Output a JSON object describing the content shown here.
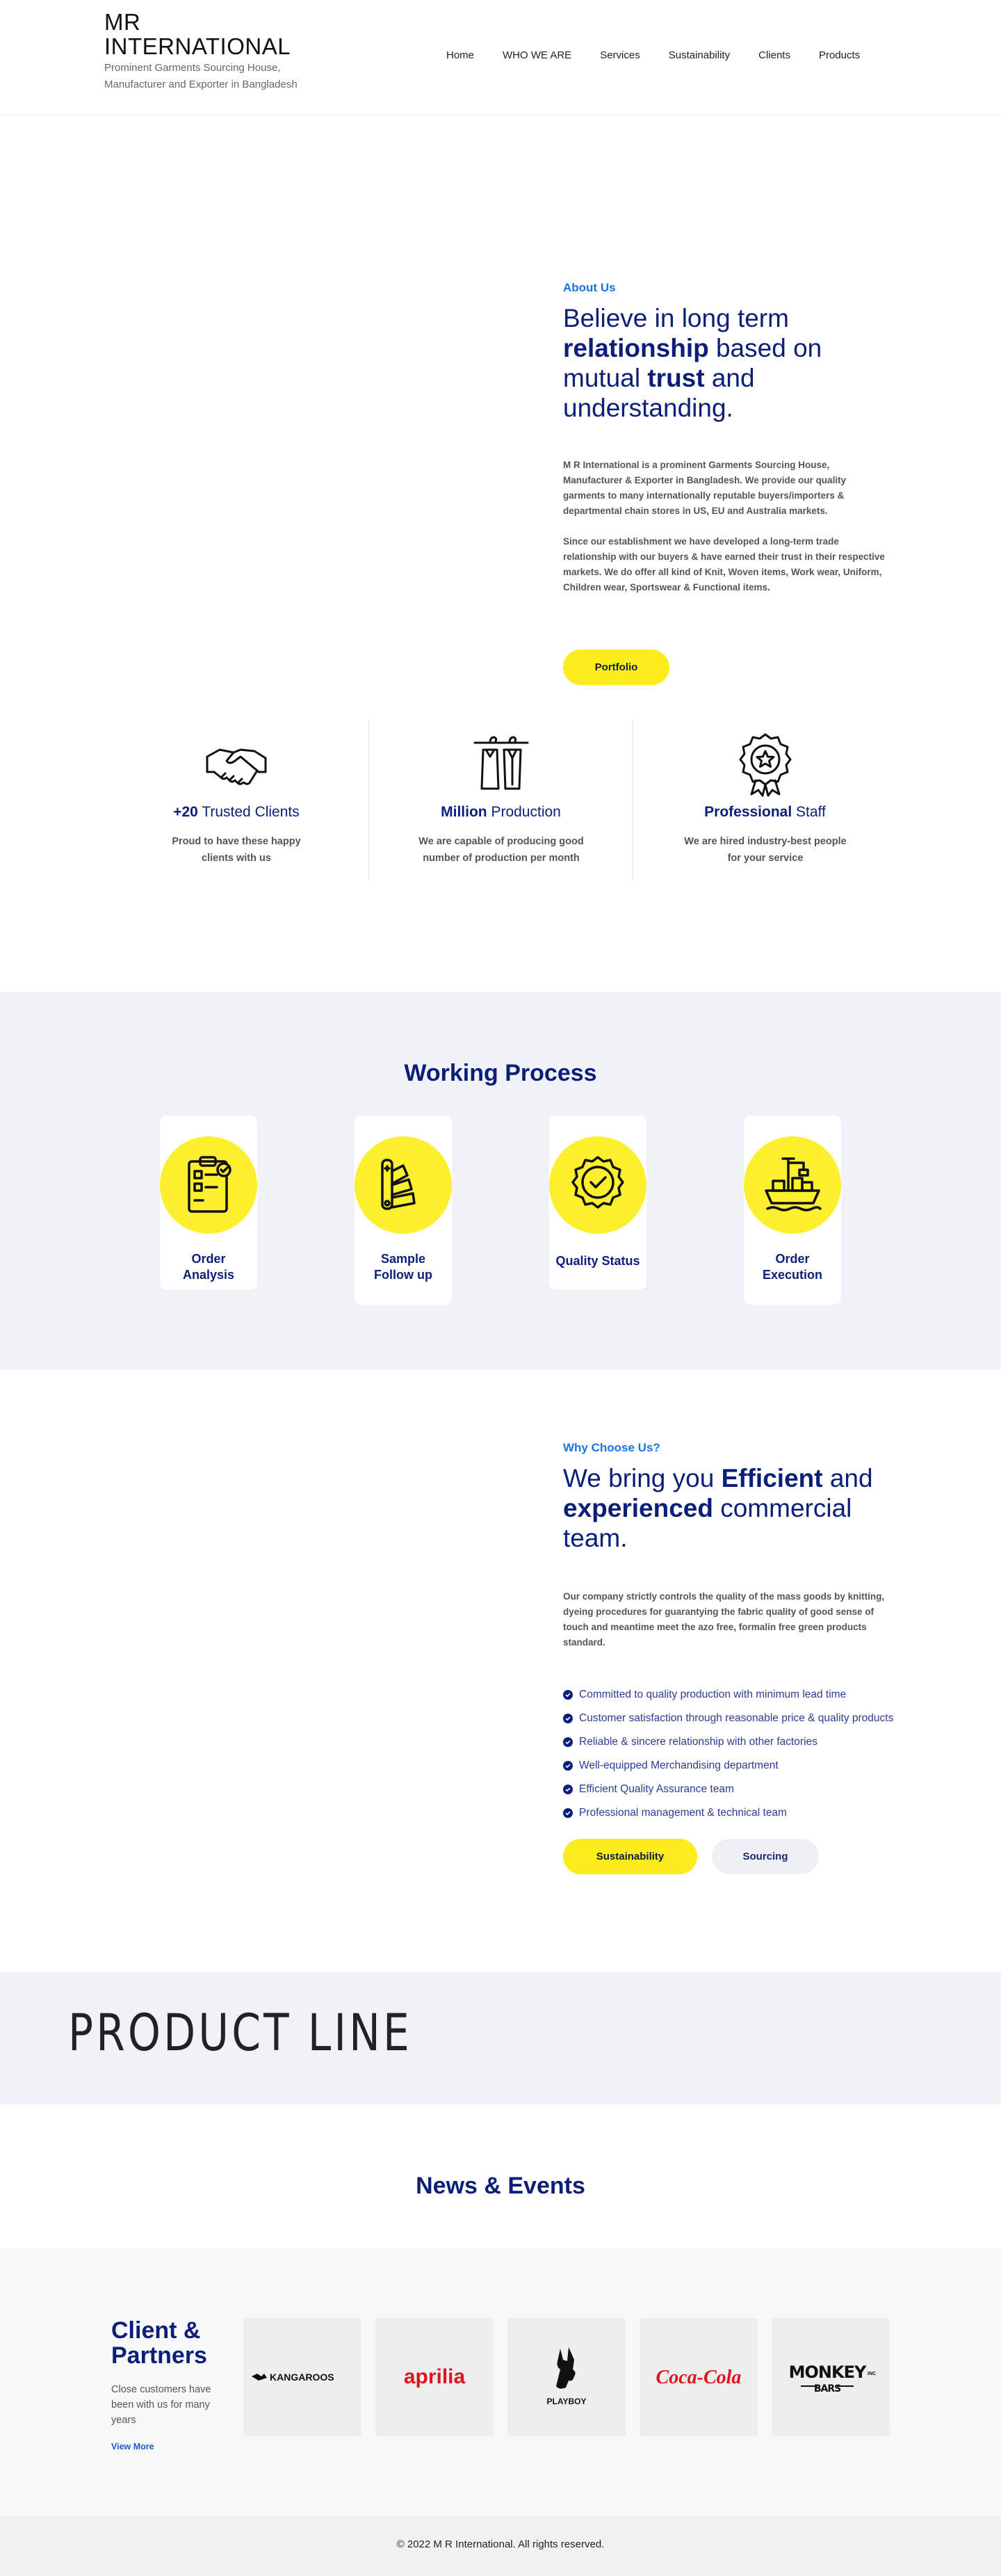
{
  "brand": {
    "name": "MR INTERNATIONAL",
    "tagline": "Prominent Garments Sourcing House, Manufacturer and Exporter in Bangladesh"
  },
  "nav": {
    "items": [
      {
        "label": "Home"
      },
      {
        "label": "WHO WE ARE"
      },
      {
        "label": "Services"
      },
      {
        "label": "Sustainability"
      },
      {
        "label": "Clients"
      },
      {
        "label": "Products"
      }
    ]
  },
  "about": {
    "eyebrow": "About Us",
    "heading": {
      "p1": "Believe in long term ",
      "b1": "relationship",
      "p2": " based on mutual ",
      "b2": "trust",
      "p3": " and understanding."
    },
    "para1": "M R International is a prominent Garments Sourcing House, Manufacturer & Exporter in Bangladesh. We provide our quality garments to many internationally reputable buyers/importers & departmental chain stores in US, EU and Australia markets.",
    "para2": "Since our establishment we have developed a long-term trade relationship with our buyers & have earned their trust in their respective markets. We do offer all kind of Knit, Woven items, Work wear, Uniform, Children wear, Sportswear & Functional items.",
    "button": "Portfolio"
  },
  "features": [
    {
      "icon": "handshake-icon",
      "bold": "+20",
      "rest": " Trusted Clients",
      "desc": "Proud to have these happy clients with us"
    },
    {
      "icon": "garments-rack-icon",
      "bold": "Million",
      "rest": " Production",
      "desc": "We are capable of producing good number of production per month"
    },
    {
      "icon": "award-badge-icon",
      "bold": "Professional",
      "rest": " Staff",
      "desc": "We are hired industry-best people for your service"
    }
  ],
  "process": {
    "title": "Working Process",
    "steps": [
      {
        "label": "Order Analysis",
        "icon": "clipboard-icon"
      },
      {
        "label": "Sample Follow up",
        "icon": "swatch-fan-icon"
      },
      {
        "label": "Quality Status",
        "icon": "quality-check-icon"
      },
      {
        "label": "Order Execution",
        "icon": "cargo-ship-icon"
      }
    ]
  },
  "why": {
    "eyebrow": "Why Choose Us?",
    "heading": {
      "p1": "We bring you ",
      "b1": "Efficient",
      "p2": " and ",
      "b2": "experienced",
      "p3": " commercial team."
    },
    "para": "Our company strictly controls the quality of the mass goods by knitting, dyeing procedures for guarantying the fabric quality of good sense of touch and meantime meet the azo free, formalin free green products standard.",
    "points": [
      "Committed to quality production with minimum lead time",
      "Customer satisfaction through reasonable price & quality products",
      "Reliable & sincere relationship with other factories",
      "Well-equipped Merchandising department",
      "Efficient Quality Assurance team",
      "Professional management & technical team"
    ],
    "buttons": {
      "primary": "Sustainability",
      "secondary": "Sourcing"
    }
  },
  "product_line": {
    "title": "PRODUCT LINE"
  },
  "news": {
    "title": "News & Events"
  },
  "clients": {
    "title": "Client & Partners",
    "desc": "Close customers have been with us for many years",
    "link": "View More",
    "logos": [
      {
        "name": "kangaroos-logo",
        "text": "KANGAROOS"
      },
      {
        "name": "aprilia-logo",
        "text": "aprilia"
      },
      {
        "name": "playboy-logo",
        "text": "PLAYBOY"
      },
      {
        "name": "coca-cola-logo",
        "text": "Coca-Cola"
      },
      {
        "name": "monkey-bars-logo",
        "text": "MONKEY BARS",
        "sub": "INC"
      }
    ]
  },
  "footer": {
    "copyright": "© 2022 M R International. All rights reserved."
  },
  "colors": {
    "primary_navy": "#0b1f7a",
    "accent_blue": "#1a73e8",
    "yellow": "#fcec1d",
    "section_grey": "#f1f2f8"
  }
}
